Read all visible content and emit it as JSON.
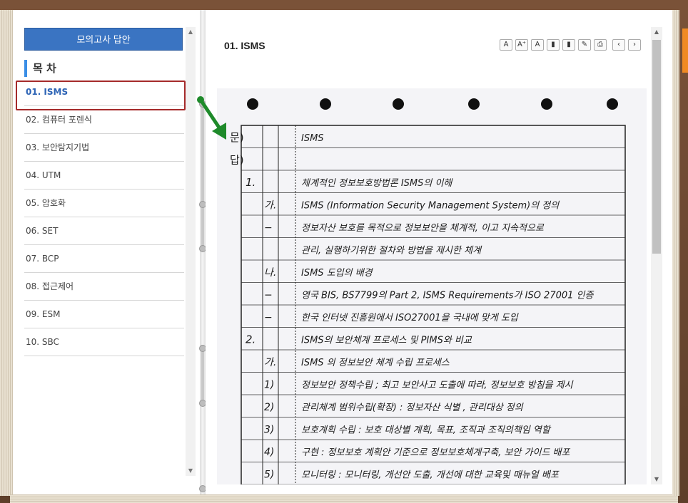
{
  "sidebar": {
    "answer_button": "모의고사 답안",
    "toc_title": "목 차",
    "items": [
      {
        "label": "01. ISMS",
        "active": true
      },
      {
        "label": "02. 컴퓨터 포렌식",
        "active": false
      },
      {
        "label": "03. 보안탐지기법",
        "active": false
      },
      {
        "label": "04. UTM",
        "active": false
      },
      {
        "label": "05. 암호화",
        "active": false
      },
      {
        "label": "06. SET",
        "active": false
      },
      {
        "label": "07. BCP",
        "active": false
      },
      {
        "label": "08. 접근제어",
        "active": false
      },
      {
        "label": "09. ESM",
        "active": false
      },
      {
        "label": "10. SBC",
        "active": false
      }
    ]
  },
  "content": {
    "title": "01. ISMS",
    "toolbar_icons": [
      "font-larger-icon",
      "font-increase-icon",
      "font-decrease-icon",
      "bookmark-icon",
      "bookmark-add-icon",
      "memo-icon",
      "print-icon",
      "prev-page-icon",
      "next-page-icon"
    ],
    "toolbar_glyphs": [
      "A",
      "A⁺",
      "A",
      "▮",
      "▮",
      "✎",
      "⎙",
      "‹",
      "›"
    ],
    "scan": {
      "col_labels": [
        "문)",
        "답)"
      ],
      "lines": [
        {
          "num": "",
          "sub": "",
          "text": "ISMS"
        },
        {
          "num": "",
          "sub": "",
          "text": ""
        },
        {
          "num": "1.",
          "sub": "",
          "text": "체계적인 정보보호방법론 ISMS의 이해"
        },
        {
          "num": "",
          "sub": "가.",
          "text": "ISMS (Information Security Management System)의 정의"
        },
        {
          "num": "",
          "sub": "−",
          "text": "정보자산 보호를 목적으로 정보보안을 체계적, 이고 지속적으로"
        },
        {
          "num": "",
          "sub": "",
          "text": "관리, 실행하기위한 절차와 방법을 제시한 체계"
        },
        {
          "num": "",
          "sub": "나.",
          "text": "ISMS 도입의 배경"
        },
        {
          "num": "",
          "sub": "−",
          "text": "영국 BIS, BS7799의 Part 2, ISMS Requirements가 ISO 27001 인증"
        },
        {
          "num": "",
          "sub": "−",
          "text": "한국 인터넷 진흥원에서 ISO27001을 국내에 맞게 도입"
        },
        {
          "num": "2.",
          "sub": "",
          "text": "ISMS의 보안체계 프로세스 및 PIMS와 비교"
        },
        {
          "num": "",
          "sub": "가.",
          "text": "ISMS 의 정보보안 체계 수립 프로세스"
        },
        {
          "num": "",
          "sub": "1)",
          "text": "정보보안 정책수립 ; 최고 보안사고 도출에 따라, 정보보호 방침을 제시"
        },
        {
          "num": "",
          "sub": "2)",
          "text": "관리체계 범위수립(확장) : 정보자산 식별 , 관리대상 정의"
        },
        {
          "num": "",
          "sub": "3)",
          "text": "보호계획 수립 : 보호 대상별 계획, 목표, 조직과 조직의책임 역할"
        },
        {
          "num": "",
          "sub": "4)",
          "text": "구현 : 정보보호 계획안 기준으로 정보보호체계구축, 보안 가이드 배포"
        },
        {
          "num": "",
          "sub": "5)",
          "text": "모니터링 : 모니터링, 개선안 도출, 개선에 대한 교육및 매뉴얼 배포"
        }
      ]
    }
  },
  "colors": {
    "answer_button_bg": "#3a74c2",
    "active_item": "#2c63b5",
    "highlight_box": "#a52a2a",
    "arrow": "#1e8a2a",
    "frame": "#6b4a33"
  }
}
